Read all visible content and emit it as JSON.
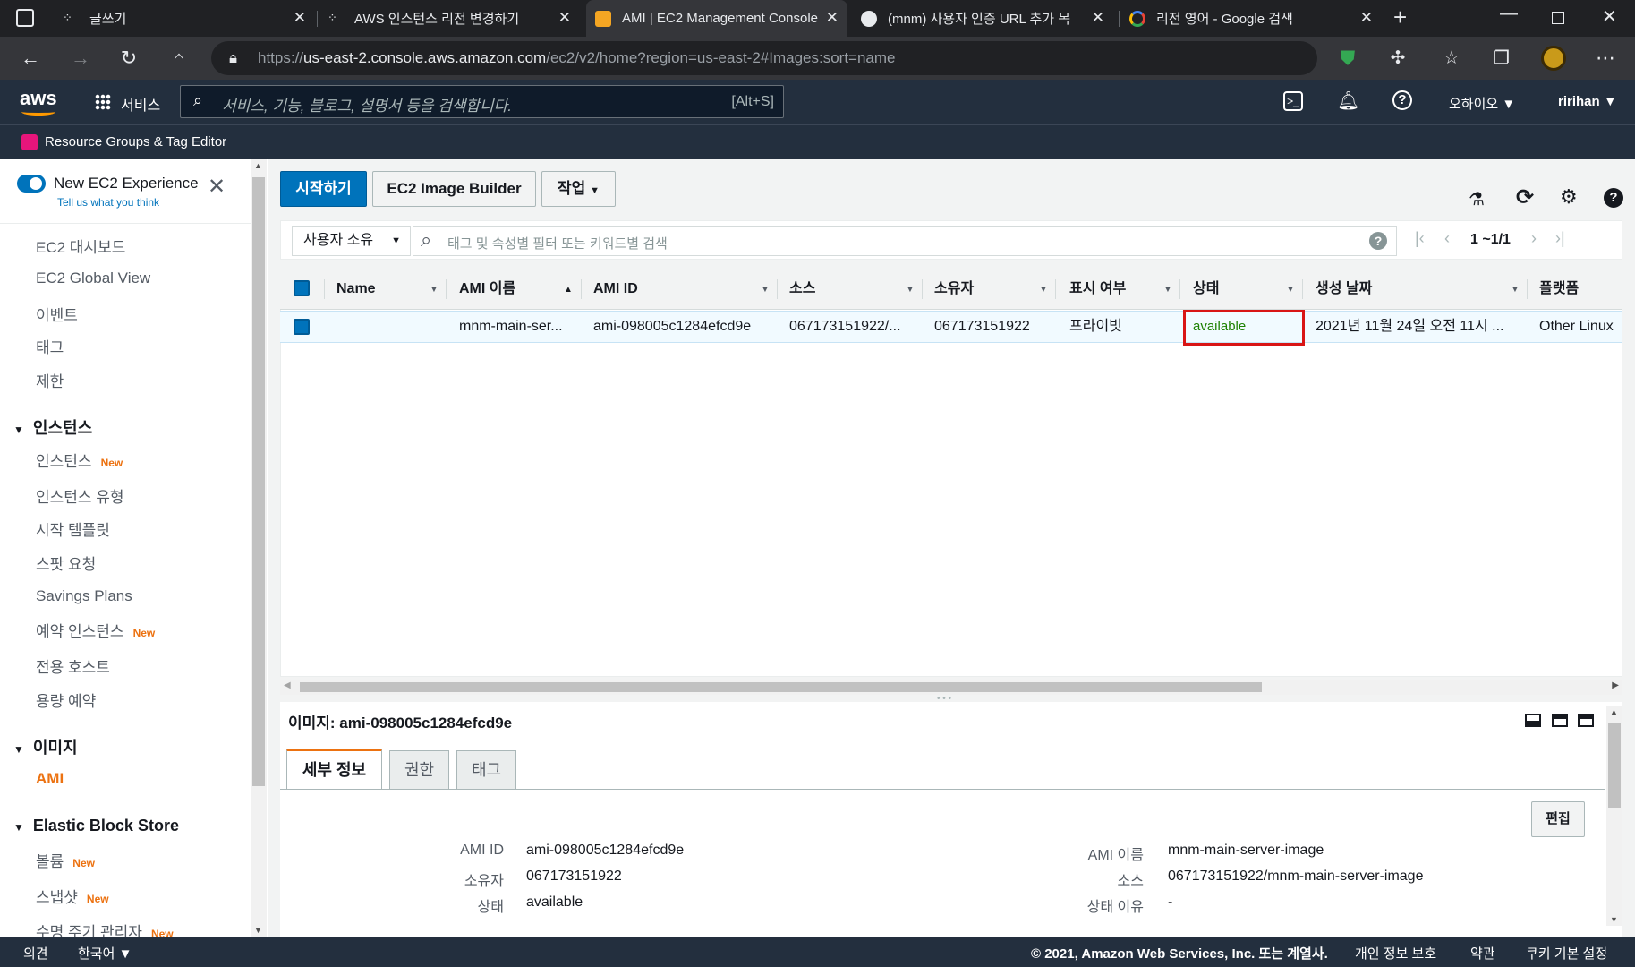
{
  "browser": {
    "tabs": [
      {
        "title": "글쓰기",
        "active": false
      },
      {
        "title": "AWS 인스턴스 리전 변경하기",
        "active": false
      },
      {
        "title": "AMI | EC2 Management Console",
        "active": true
      },
      {
        "title": "(mnm) 사용자 인증 URL 추가 목",
        "active": false
      },
      {
        "title": "리전 영어 - Google 검색",
        "active": false
      }
    ],
    "url_prefix": "https://",
    "url_host": "us-east-2.console.aws.amazon.com",
    "url_path": "/ec2/v2/home?region=us-east-2#Images:sort=name"
  },
  "aws_header": {
    "logo": "aws",
    "services": "서비스",
    "search_placeholder": "서비스, 기능, 블로그, 설명서 등을 검색합니다.",
    "search_shortcut": "[Alt+S]",
    "region": "오하이오 ▼",
    "user": "ririhan ▼",
    "resource_groups": "Resource Groups & Tag Editor"
  },
  "sidebar": {
    "new_experience": "New EC2 Experience",
    "tell_us": "Tell us what you think",
    "items_top": [
      "EC2 대시보드",
      "EC2 Global View",
      "이벤트",
      "태그",
      "제한"
    ],
    "instances_head": "인스턴스",
    "instances_items": [
      {
        "label": "인스턴스",
        "new": "New"
      },
      {
        "label": "인스턴스 유형",
        "new": ""
      },
      {
        "label": "시작 템플릿",
        "new": ""
      },
      {
        "label": "스팟 요청",
        "new": ""
      },
      {
        "label": "Savings Plans",
        "new": ""
      },
      {
        "label": "예약 인스턴스",
        "new": "New"
      },
      {
        "label": "전용 호스트",
        "new": ""
      },
      {
        "label": "용량 예약",
        "new": ""
      }
    ],
    "images_head": "이미지",
    "images_items": [
      "AMI"
    ],
    "ebs_head": "Elastic Block Store",
    "ebs_items": [
      {
        "label": "볼륨",
        "new": "New"
      },
      {
        "label": "스냅샷",
        "new": "New"
      },
      {
        "label": "수명 주기 관리자",
        "new": "New"
      }
    ]
  },
  "toolbar": {
    "launch": "시작하기",
    "image_builder": "EC2 Image Builder",
    "actions": "작업"
  },
  "filter": {
    "owner": "사용자 소유",
    "placeholder": "태그 및 속성별 필터 또는 키워드별 검색",
    "pagination": "1 ~1/1"
  },
  "table": {
    "columns": [
      "Name",
      "AMI 이름",
      "AMI ID",
      "소스",
      "소유자",
      "표시 여부",
      "상태",
      "생성 날짜",
      "플랫폼"
    ],
    "rows": [
      {
        "name": "",
        "ami_name": "mnm-main-ser...",
        "ami_id": "ami-098005c1284efcd9e",
        "source": "067173151922/...",
        "owner": "067173151922",
        "visibility": "프라이빗",
        "status": "available",
        "created": "2021년 11월 24일 오전 11시 ...",
        "platform": "Other Linux"
      }
    ]
  },
  "detail": {
    "title": "이미지: ami-098005c1284efcd9e",
    "tabs": [
      "세부 정보",
      "권한",
      "태그"
    ],
    "edit": "편집",
    "left": [
      {
        "label": "AMI ID",
        "value": "ami-098005c1284efcd9e"
      },
      {
        "label": "소유자",
        "value": "067173151922"
      },
      {
        "label": "상태",
        "value": "available"
      }
    ],
    "right": [
      {
        "label": "AMI 이름",
        "value": "mnm-main-server-image"
      },
      {
        "label": "소스",
        "value": "067173151922/mnm-main-server-image"
      },
      {
        "label": "상태 이유",
        "value": "-"
      }
    ]
  },
  "footer": {
    "feedback": "의견",
    "language": "한국어 ▼",
    "copyright": "© 2021, Amazon Web Services, Inc. 또는 계열사.",
    "privacy": "개인 정보 보호",
    "terms": "약관",
    "cookies": "쿠키 기본 설정"
  },
  "colors": {
    "aws_dark": "#232f3e",
    "primary": "#0073bb",
    "orange": "#ec7211",
    "available": "#1d8102",
    "highlight_border": "#d91515"
  }
}
